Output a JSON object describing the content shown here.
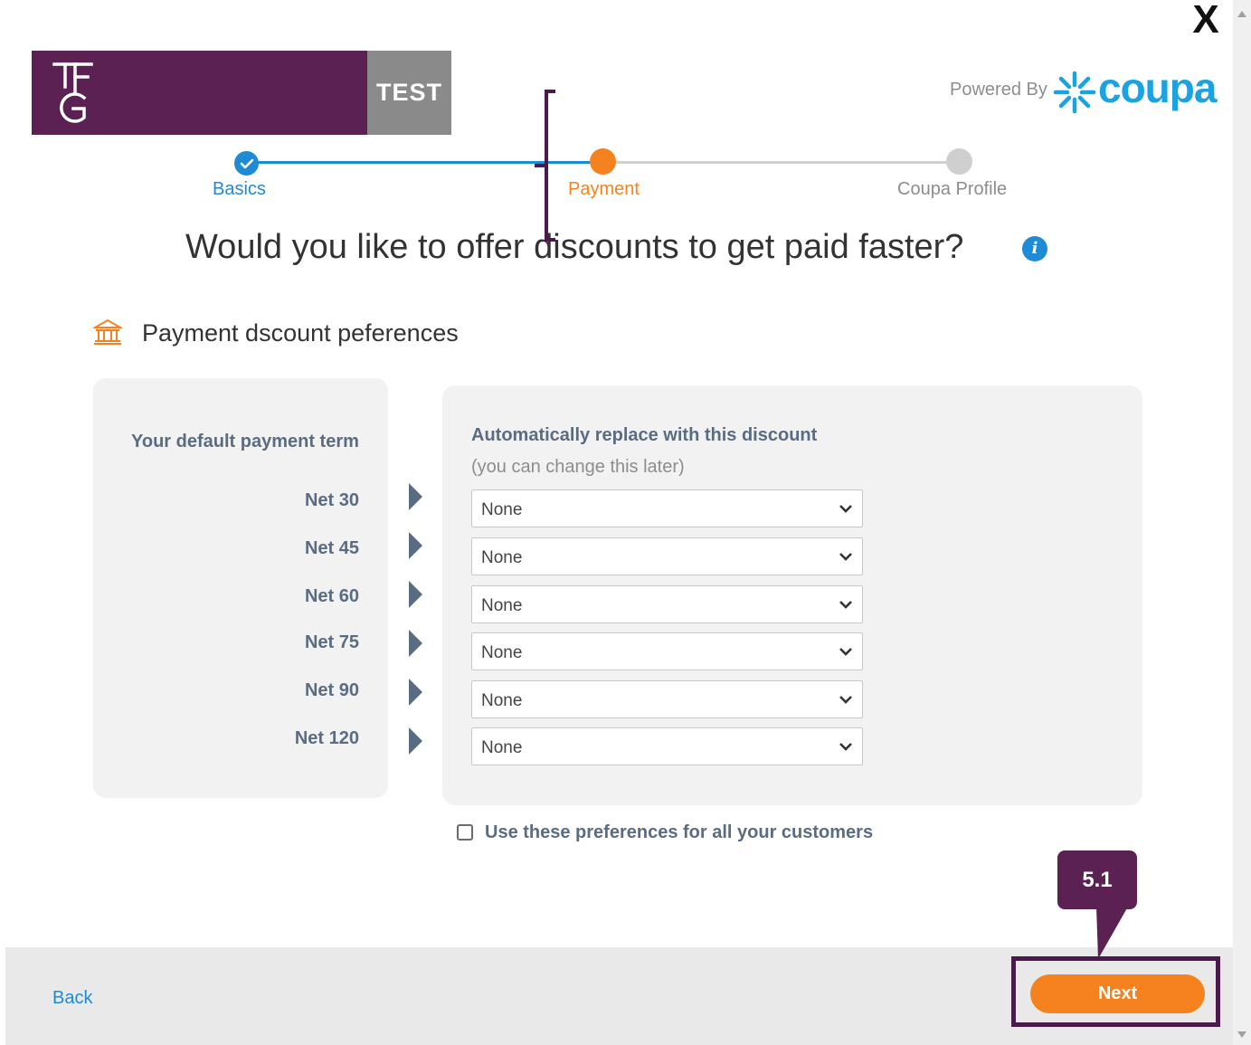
{
  "header": {
    "logo_text": "TFG",
    "logo_badge": "TEST",
    "powered_by": "Powered By",
    "brand": "coupa",
    "close_label": "X"
  },
  "stepper": {
    "steps": [
      {
        "label": "Basics",
        "state": "done"
      },
      {
        "label": "Payment",
        "state": "active"
      },
      {
        "label": "Coupa Profile",
        "state": "todo"
      }
    ]
  },
  "main": {
    "heading": "Would you like to offer discounts to get paid faster?",
    "info_icon": "i",
    "section_title": "Payment dscount peferences",
    "left_header": "Your default payment term",
    "right_header": "Automatically replace with this discount",
    "right_subheader": "(you can change this later)",
    "terms": [
      {
        "term": "Net 30",
        "discount": "None"
      },
      {
        "term": "Net 45",
        "discount": "None"
      },
      {
        "term": "Net 60",
        "discount": "None"
      },
      {
        "term": "Net 75",
        "discount": "None"
      },
      {
        "term": "Net 90",
        "discount": "None"
      },
      {
        "term": "Net 120",
        "discount": "None"
      }
    ],
    "checkbox_label": "Use these preferences for all your customers",
    "checkbox_checked": false
  },
  "annotation": {
    "callout": "5.1"
  },
  "footer": {
    "back_label": "Back",
    "next_label": "Next"
  },
  "colors": {
    "brand_purple": "#5b2152",
    "accent_orange": "#f5821f",
    "link_blue": "#1f8ad6",
    "coupa_blue": "#1ba2e0"
  }
}
